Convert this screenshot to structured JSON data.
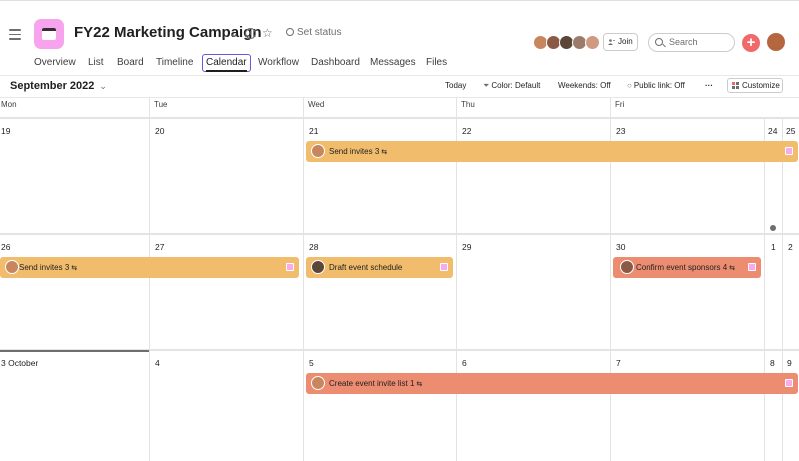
{
  "header": {
    "title": "FY22 Marketing Campaign",
    "set_status": "Set status",
    "join_label": "Join",
    "search_placeholder": "Search",
    "plus_label": "+"
  },
  "tabs": [
    {
      "label": "Overview"
    },
    {
      "label": "List"
    },
    {
      "label": "Board"
    },
    {
      "label": "Timeline"
    },
    {
      "label": "Calendar",
      "active": true
    },
    {
      "label": "Workflow"
    },
    {
      "label": "Dashboard"
    },
    {
      "label": "Messages"
    },
    {
      "label": "Files"
    }
  ],
  "toolbar": {
    "month": "September 2022",
    "today": "Today",
    "color": "Color: Default",
    "weekends": "Weekends: Off",
    "public_link": "Public link: Off",
    "more": "···",
    "customize": "Customize"
  },
  "weekdays": [
    "Mon",
    "Tue",
    "Wed",
    "Thu",
    "Fri"
  ],
  "weeks": [
    {
      "dates": [
        "19",
        "20",
        "21",
        "22",
        "23",
        "24",
        "25"
      ]
    },
    {
      "dates": [
        "26",
        "27",
        "28",
        "29",
        "30",
        "1",
        "2"
      ]
    },
    {
      "dates": [
        "3 October",
        "4",
        "5",
        "6",
        "7",
        "8",
        "9"
      ]
    }
  ],
  "events": [
    {
      "title": "Send invites",
      "subtasks": "3",
      "color": "yellow",
      "week": 0
    },
    {
      "title": "Send invites",
      "subtasks": "3",
      "color": "yellow",
      "week": 1
    },
    {
      "title": "Draft event schedule",
      "subtasks": "",
      "color": "yellow",
      "week": 1
    },
    {
      "title": "Confirm event sponsors",
      "subtasks": "4",
      "color": "orange",
      "week": 1
    },
    {
      "title": "Create event invite list",
      "subtasks": "1",
      "color": "orange",
      "week": 2
    }
  ],
  "colors": {
    "accent": "#6a57e0",
    "event_yellow": "#f1bd6c",
    "event_orange": "#ec8d71",
    "add_button": "#f06a6a",
    "app_icon": "#f7a3ee"
  },
  "icons": {
    "hamburger": "menu-icon",
    "app": "calendar-icon",
    "chevron": "chevron-down-icon",
    "info": "info-icon",
    "star": "star-icon",
    "subtask": "subtask-icon"
  }
}
